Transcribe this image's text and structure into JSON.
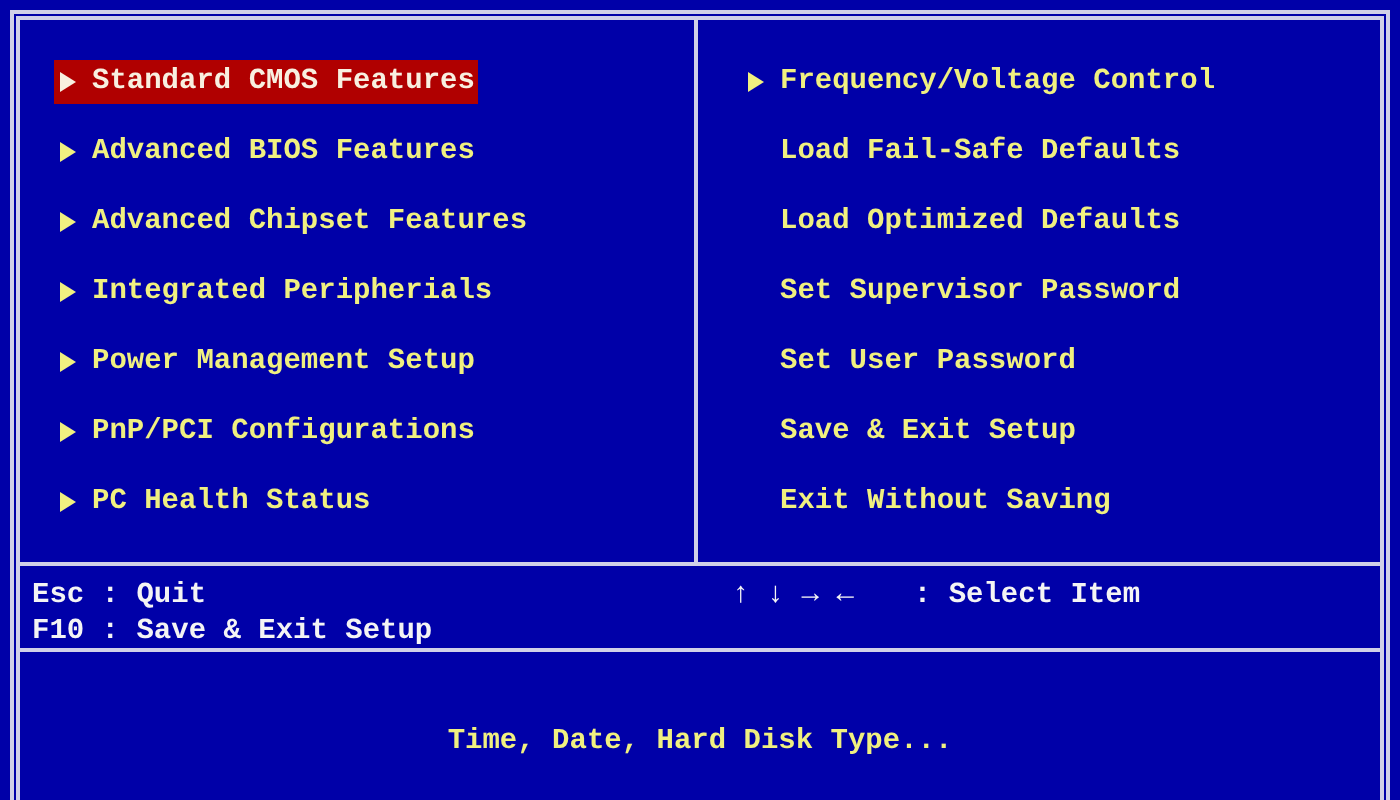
{
  "left_menu": [
    {
      "label": "Standard CMOS Features",
      "submenu": true,
      "selected": true
    },
    {
      "label": "Advanced BIOS Features",
      "submenu": true,
      "selected": false
    },
    {
      "label": "Advanced Chipset Features",
      "submenu": true,
      "selected": false
    },
    {
      "label": "Integrated Peripherials",
      "submenu": true,
      "selected": false
    },
    {
      "label": "Power Management Setup",
      "submenu": true,
      "selected": false
    },
    {
      "label": "PnP/PCI Configurations",
      "submenu": true,
      "selected": false
    },
    {
      "label": "PC Health Status",
      "submenu": true,
      "selected": false
    }
  ],
  "right_menu": [
    {
      "label": "Frequency/Voltage Control",
      "submenu": true,
      "selected": false
    },
    {
      "label": "Load Fail-Safe Defaults",
      "submenu": false,
      "selected": false
    },
    {
      "label": "Load Optimized Defaults",
      "submenu": false,
      "selected": false
    },
    {
      "label": "Set Supervisor Password",
      "submenu": false,
      "selected": false
    },
    {
      "label": "Set User Password",
      "submenu": false,
      "selected": false
    },
    {
      "label": "Save & Exit Setup",
      "submenu": false,
      "selected": false
    },
    {
      "label": "Exit Without Saving",
      "submenu": false,
      "selected": false
    }
  ],
  "key_help": {
    "left": [
      "Esc : Quit",
      "F10 : Save & Exit Setup"
    ],
    "arrows": "↑ ↓ → ←",
    "arrows_action": ": Select Item"
  },
  "description": "Time, Date, Hard Disk Type..."
}
